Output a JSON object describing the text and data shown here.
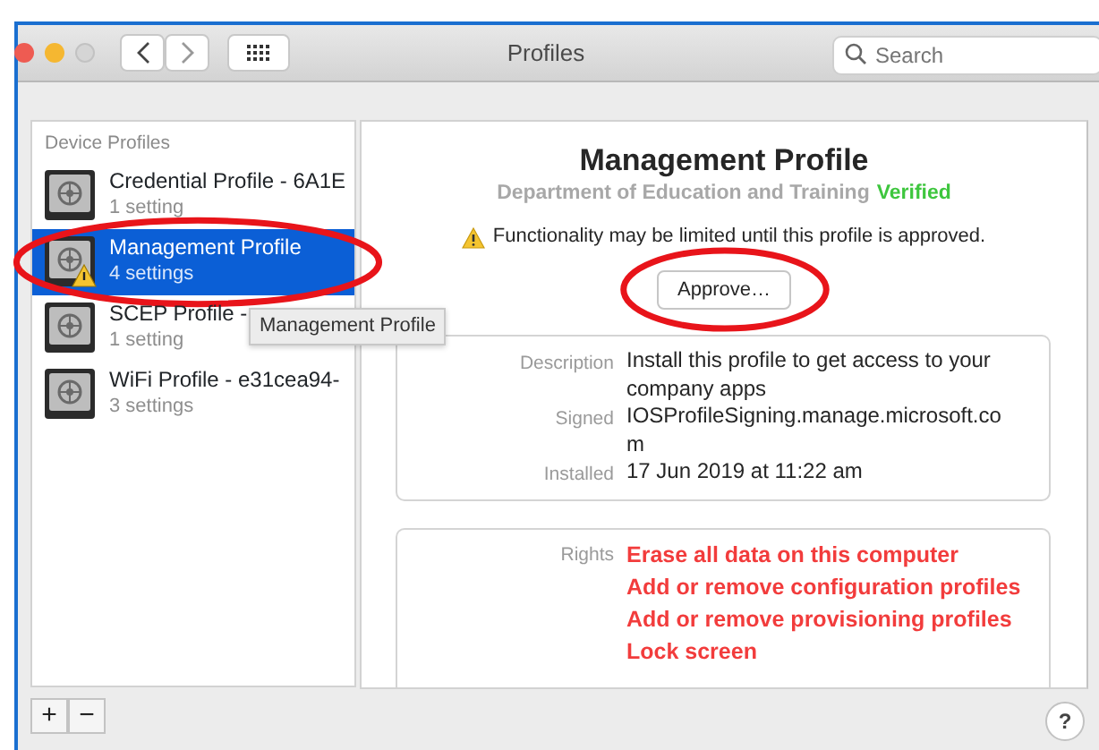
{
  "window": {
    "title": "Profiles"
  },
  "search": {
    "placeholder": "Search"
  },
  "sidebar": {
    "header": "Device Profiles",
    "items": [
      {
        "name": "Credential Profile - 6A1E",
        "detail": "1 setting",
        "selected": false,
        "warning": false,
        "highlighted": false
      },
      {
        "name": "Management Profile",
        "detail": "4 settings",
        "selected": true,
        "warning": true,
        "highlighted": true
      },
      {
        "name": "SCEP Profile -",
        "detail": "1 setting",
        "selected": false,
        "warning": false,
        "highlighted": false
      },
      {
        "name": "WiFi Profile - e31cea94-",
        "detail": "3 settings",
        "selected": false,
        "warning": false,
        "highlighted": false
      }
    ]
  },
  "tooltip": "Management Profile",
  "sidebar_buttons": [
    "+",
    "−"
  ],
  "profile": {
    "title": "Management Profile",
    "organization": "Department of Education and Training",
    "verification": "Verified",
    "warning": "Functionality may be limited until this profile is approved.",
    "approve_button": {
      "label": "Approve…",
      "highlighted": true
    },
    "details": [
      {
        "label": "Description",
        "value": "Install this profile to get access to your company apps"
      },
      {
        "label": "Signed",
        "value": "IOSProfileSigning.manage.microsoft.co m"
      },
      {
        "label": "Installed",
        "value": "17 Jun 2019 at 11:22 am"
      }
    ],
    "rights_label": "Rights",
    "rights": [
      "Erase all data on this computer",
      "Add or remove configuration profiles",
      "Add or remove provisioning profiles",
      "Lock screen"
    ]
  },
  "help_button": "?"
}
